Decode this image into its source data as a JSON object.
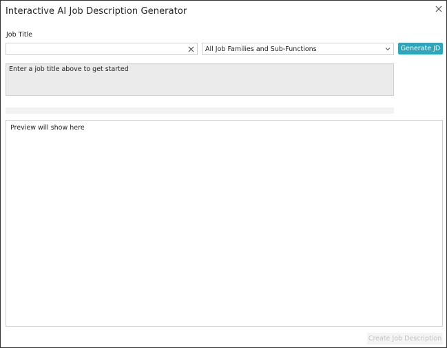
{
  "dialog": {
    "title": "Interactive AI Job Description Generator",
    "close_icon": "close-icon"
  },
  "form": {
    "job_title_label": "Job Title",
    "job_title_value": "",
    "job_title_placeholder": "",
    "clear_icon": "close-icon",
    "family_select_value": "All Job Families and Sub-Functions",
    "select_icon": "chevron-down-icon",
    "generate_label": "Generate JD"
  },
  "hint": {
    "text": "Enter a job title above to get started"
  },
  "progress": {
    "value_percent": 0
  },
  "preview": {
    "text": "Preview will show here"
  },
  "footer": {
    "create_label": "Create Job Description",
    "create_disabled": true
  },
  "colors": {
    "accent": "#2ba6bd",
    "disabled_text": "#c2c2c2",
    "panel_bg": "#ebebeb"
  }
}
